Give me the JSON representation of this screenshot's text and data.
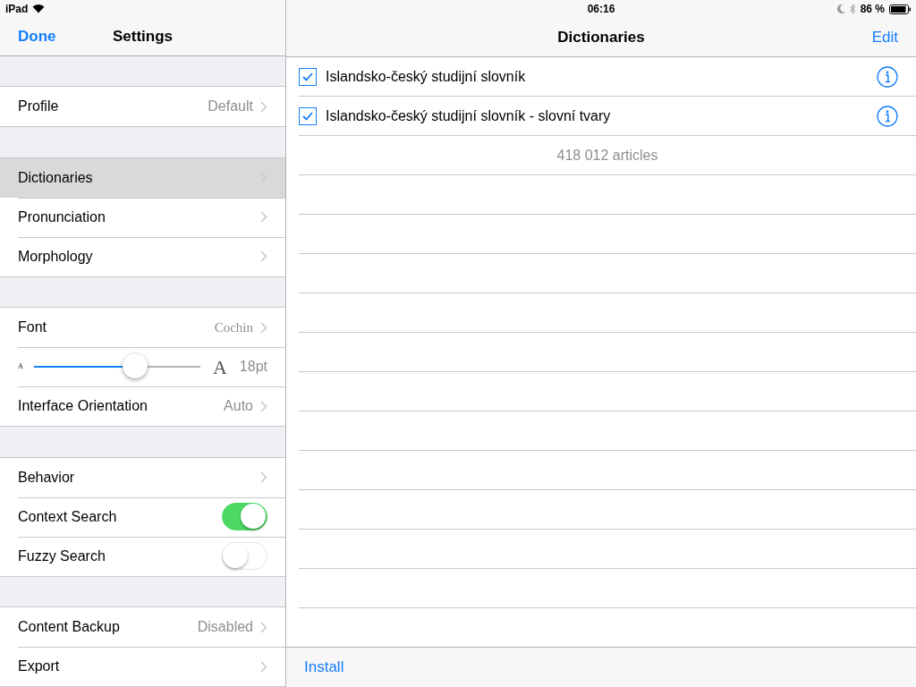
{
  "status_bar": {
    "device": "iPad",
    "time": "06:16",
    "battery": "86 %"
  },
  "sidebar": {
    "nav": {
      "left_button": "Done",
      "title": "Settings"
    },
    "groups": [
      [
        {
          "kind": "disclosure",
          "label": "Profile",
          "value": "Default",
          "selected": false
        }
      ],
      [
        {
          "kind": "disclosure",
          "label": "Dictionaries",
          "selected": true
        },
        {
          "kind": "disclosure",
          "label": "Pronunciation",
          "selected": false
        },
        {
          "kind": "disclosure",
          "label": "Morphology",
          "selected": false
        }
      ],
      [
        {
          "kind": "font",
          "label": "Font",
          "value": "Cochin",
          "selected": false
        },
        {
          "kind": "slider",
          "small_label": "A",
          "large_label": "A",
          "value": "18pt",
          "level": 0.61
        },
        {
          "kind": "disclosure",
          "label": "Interface Orientation",
          "value": "Auto",
          "selected": false
        }
      ],
      [
        {
          "kind": "disclosure",
          "label": "Behavior",
          "selected": false
        },
        {
          "kind": "toggle",
          "label": "Context Search",
          "on": true
        },
        {
          "kind": "toggle",
          "label": "Fuzzy Search",
          "on": false
        }
      ],
      [
        {
          "kind": "disclosure",
          "label": "Content Backup",
          "value": "Disabled",
          "selected": false
        },
        {
          "kind": "disclosure",
          "label": "Export",
          "selected": false
        }
      ]
    ]
  },
  "detail": {
    "nav": {
      "title": "Dictionaries",
      "right_button": "Edit"
    },
    "dictionaries": [
      {
        "name": "Islandsko-český studijní slovník",
        "checked": true
      },
      {
        "name": "Islandsko-český studijní slovník - slovní tvary",
        "checked": true
      }
    ],
    "footer": "418 012 articles",
    "toolbar": {
      "button": "Install"
    }
  }
}
